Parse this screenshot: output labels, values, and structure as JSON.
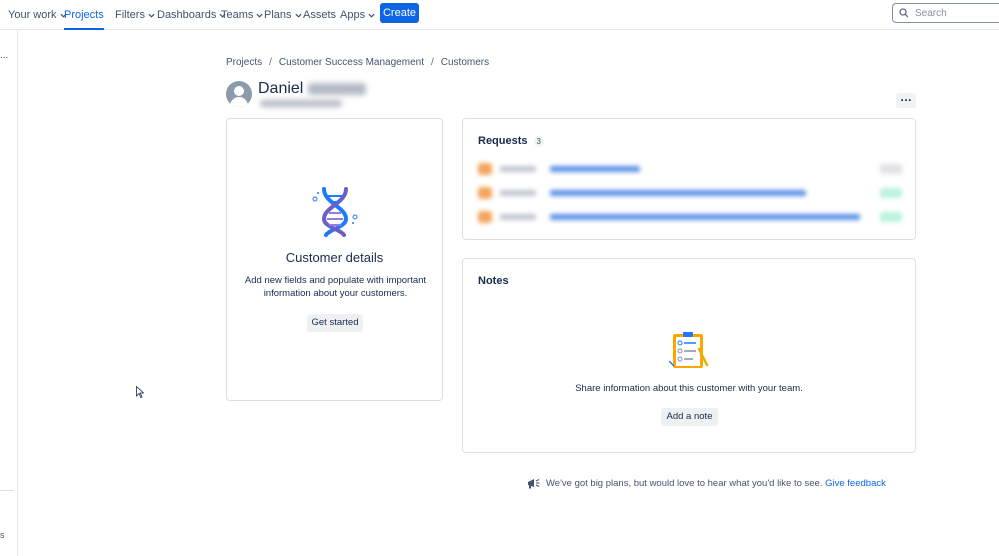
{
  "nav": {
    "items": [
      {
        "label": "Your work",
        "dropdown": true
      },
      {
        "label": "Projects",
        "dropdown": true,
        "active": true
      },
      {
        "label": "Filters",
        "dropdown": true
      },
      {
        "label": "Dashboards",
        "dropdown": true
      },
      {
        "label": "Teams",
        "dropdown": true
      },
      {
        "label": "Plans",
        "dropdown": true
      },
      {
        "label": "Assets",
        "dropdown": false
      },
      {
        "label": "Apps",
        "dropdown": true
      }
    ],
    "create_label": "Create",
    "search_placeholder": "Search"
  },
  "leftrail": {
    "top_text": "...",
    "bottom_text": "s"
  },
  "breadcrumb": {
    "items": [
      "Projects",
      "Customer Success Management",
      "Customers"
    ],
    "separator": "/"
  },
  "profile": {
    "first_name": "Daniel"
  },
  "customer_details": {
    "title": "Customer details",
    "description": "Add new fields and populate with important information about your customers.",
    "button_label": "Get started"
  },
  "requests": {
    "title": "Requests",
    "count": "3"
  },
  "notes": {
    "title": "Notes",
    "description": "Share information about this customer with your team.",
    "button_label": "Add a note"
  },
  "feedback": {
    "text": "We've got big plans, but would love to hear what you'd like to see.",
    "link_label": "Give feedback"
  },
  "colors": {
    "accent": "#0c66e4",
    "text": "#172b4d",
    "border": "#dcdfe4"
  }
}
